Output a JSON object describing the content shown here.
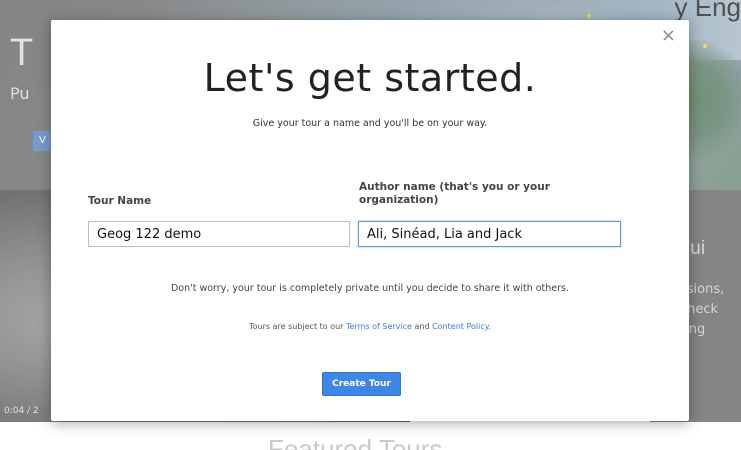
{
  "background": {
    "hero_title": "T",
    "hero_subtitle": "Pu",
    "hero_button_label": "V",
    "top_right_text": "y Eng",
    "video_time": "0:04 / 2",
    "side_heading": "r Bui",
    "side_text": "ssions,\n check\nting",
    "section_heading": "Featured Tours"
  },
  "modal": {
    "close_glyph": "×",
    "title": "Let's get started.",
    "subtitle": "Give your tour a name and you'll be on your way.",
    "tour_name": {
      "label": "Tour Name",
      "value": "Geog 122 demo"
    },
    "author_name": {
      "label": "Author name (that's you or your organization)",
      "value": "Ali, Sinéad, Lia and Jack"
    },
    "privacy_note": "Don't worry, your tour is completely private until you decide to share it with others.",
    "terms": {
      "prefix": "Tours are subject to our ",
      "terms_link": "Terms of Service",
      "joiner": " and ",
      "policy_link": "Content Policy",
      "suffix": "."
    },
    "create_button": "Create Tour"
  },
  "colors": {
    "primary_button": "#3e87e6",
    "link": "#3b78d8",
    "focused_input_border": "#5b9bd5"
  }
}
